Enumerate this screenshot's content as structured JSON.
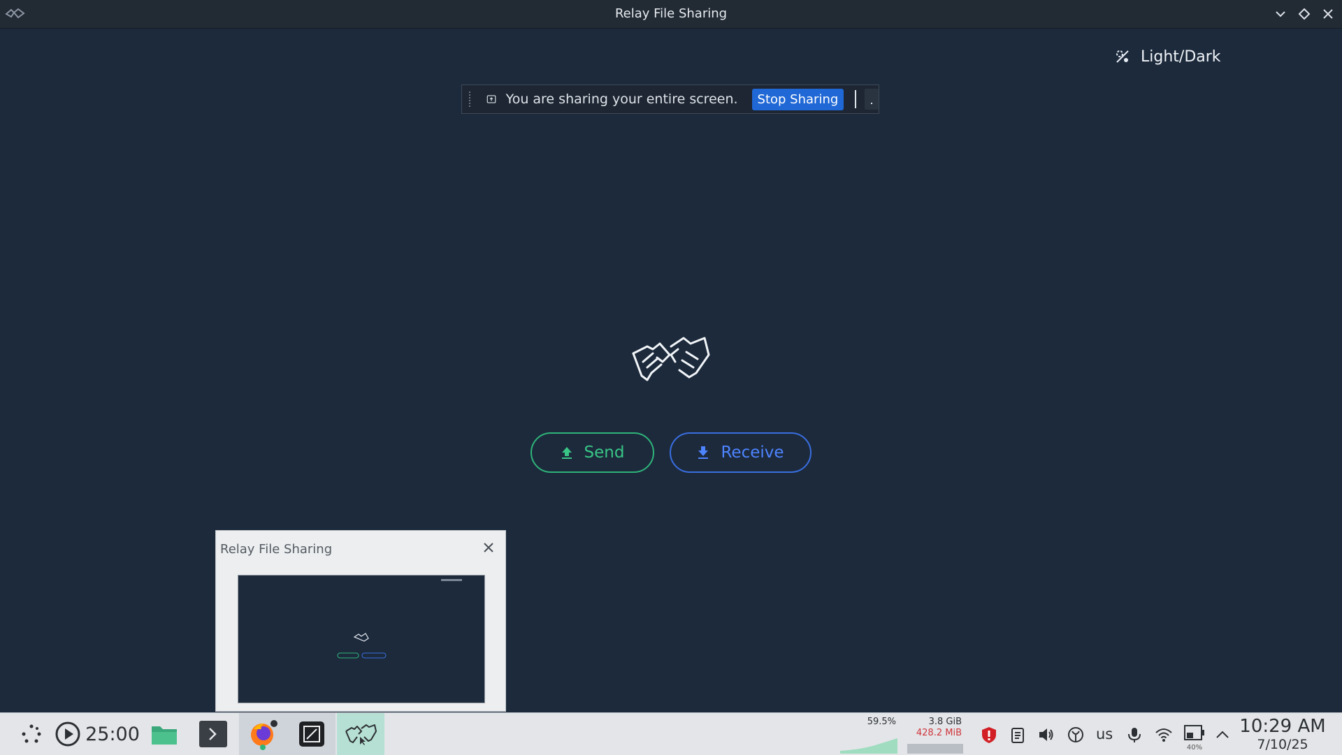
{
  "window": {
    "title": "Relay File Sharing",
    "controls": [
      "chevron-down-icon",
      "diamond-icon",
      "close-icon"
    ]
  },
  "theme_toggle": {
    "label": "Light/Dark",
    "icon": "theme-toggle-icon"
  },
  "share_banner": {
    "message": "You are sharing your entire screen.",
    "stop_label": "Stop Sharing",
    "accent": "#1f68d6"
  },
  "main": {
    "logo_icon": "handshake-icon",
    "send_label": "Send",
    "receive_label": "Receive",
    "send_color": "#2fb47a",
    "receive_color": "#3a6ee0",
    "background": "#1c2a3c"
  },
  "taskbar_preview": {
    "title": "Relay File Sharing"
  },
  "taskbar": {
    "timer": "25:00",
    "cpu_percent": "59.5%",
    "memory_total": "3.8 GiB",
    "memory_used": "428.2 MiB",
    "keyboard_layout": "us",
    "battery_percent": "40%",
    "time": "10:29 AM",
    "date": "7/10/25",
    "launchers": [
      "app-launcher-icon",
      "timer-icon",
      "file-manager-icon",
      "terminal-icon",
      "firefox-icon",
      "zed-editor-icon",
      "relay-icon"
    ],
    "tray": [
      "security-shield-icon",
      "clipboard-icon",
      "volume-icon",
      "vpn-icon",
      "microphone-icon",
      "wifi-icon",
      "battery-icon",
      "chevron-up-icon"
    ]
  }
}
